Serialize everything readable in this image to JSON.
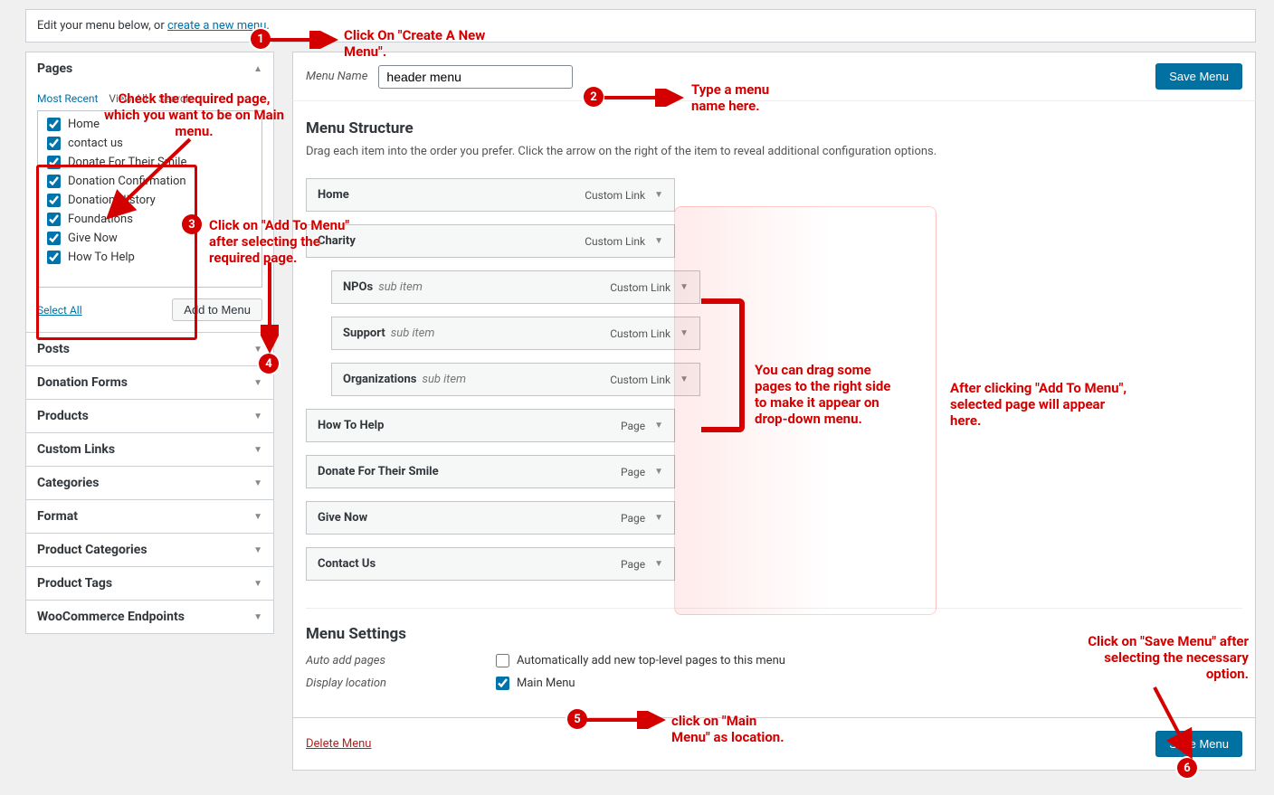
{
  "topbar": {
    "prefix": "Edit your menu below, or ",
    "link": "create a new menu",
    "suffix": "."
  },
  "sidebar": {
    "pages_title": "Pages",
    "tabs": {
      "recent": "Most Recent",
      "view_all": "View All",
      "search": "Search"
    },
    "items": [
      {
        "label": "Home",
        "checked": true
      },
      {
        "label": "contact us",
        "checked": true
      },
      {
        "label": "Donate For Their Smile",
        "checked": true
      },
      {
        "label": "Donation Confirmation",
        "checked": true
      },
      {
        "label": "Donation History",
        "checked": true
      },
      {
        "label": "Foundations",
        "checked": true
      },
      {
        "label": "Give Now",
        "checked": true
      },
      {
        "label": "How To Help",
        "checked": true
      }
    ],
    "select_all": "Select All",
    "add_to_menu": "Add to Menu",
    "panels": [
      "Posts",
      "Donation Forms",
      "Products",
      "Custom Links",
      "Categories",
      "Format",
      "Product Categories",
      "Product Tags",
      "WooCommerce Endpoints"
    ]
  },
  "main": {
    "menu_name_label": "Menu Name",
    "menu_name_value": "header menu",
    "save_btn": "Save Menu",
    "structure_title": "Menu Structure",
    "structure_desc": "Drag each item into the order you prefer. Click the arrow on the right of the item to reveal additional configuration options.",
    "sub_item_label": "sub item",
    "types": {
      "custom": "Custom Link",
      "page": "Page"
    },
    "items": [
      {
        "title": "Home",
        "type": "custom",
        "indent": false
      },
      {
        "title": "Charity",
        "type": "custom",
        "indent": false
      },
      {
        "title": "NPOs",
        "type": "custom",
        "indent": true
      },
      {
        "title": "Support",
        "type": "custom",
        "indent": true
      },
      {
        "title": "Organizations",
        "type": "custom",
        "indent": true
      },
      {
        "title": "How To Help",
        "type": "page",
        "indent": false
      },
      {
        "title": "Donate For Their Smile",
        "type": "page",
        "indent": false
      },
      {
        "title": "Give Now",
        "type": "page",
        "indent": false
      },
      {
        "title": "Contact Us",
        "type": "page",
        "indent": false
      }
    ],
    "settings_title": "Menu Settings",
    "auto_add_label": "Auto add pages",
    "auto_add_text": "Automatically add new top-level pages to this menu",
    "auto_add_checked": false,
    "display_loc_label": "Display location",
    "display_loc_text": "Main Menu",
    "display_loc_checked": true,
    "delete_menu": "Delete Menu"
  },
  "anno": {
    "n1": "Click On \"Create A New Menu\".",
    "n2": "Type a menu name here.",
    "hint_pages": "Check the required page, which you want to be on Main menu.",
    "n3_4": "Click on \"Add To Menu\" after selecting the required page.",
    "drag_hint": "You can drag some pages to the right side to make it appear on drop-down menu.",
    "after_add": "After clicking \"Add To Menu\", selected page will appear here.",
    "n5": "click on \"Main Menu\" as location.",
    "n6": "Click on \"Save Menu\" after selecting the necessary option."
  }
}
